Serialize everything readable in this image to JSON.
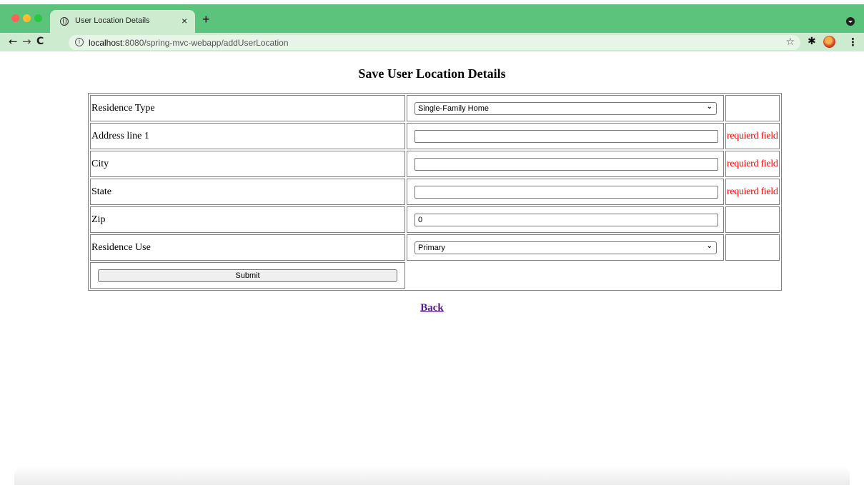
{
  "browser": {
    "tab_title": "User Location Details",
    "tab_close": "×",
    "new_tab": "+",
    "url_host": "localhost",
    "url_path": ":8080/spring-mvc-webapp/addUserLocation",
    "nav_back": "←",
    "nav_forward": "→",
    "nav_reload": "C",
    "info_glyph": "i",
    "star_glyph": "☆",
    "extensions_glyph": "✱",
    "menu_glyph": "⋮"
  },
  "page": {
    "title": "Save User Location Details",
    "rows": [
      {
        "label": "Residence Type",
        "control": "select",
        "value": "Single-Family Home",
        "error": ""
      },
      {
        "label": "Address line 1",
        "control": "input",
        "value": "",
        "error": "requierd field"
      },
      {
        "label": "City",
        "control": "input",
        "value": "",
        "error": "requierd field"
      },
      {
        "label": "State",
        "control": "input",
        "value": "",
        "error": "requierd field"
      },
      {
        "label": "Zip",
        "control": "input",
        "value": "0",
        "error": ""
      },
      {
        "label": "Residence Use",
        "control": "select",
        "value": "Primary",
        "error": ""
      }
    ],
    "submit_label": "Submit",
    "back_link": "Back"
  },
  "colors": {
    "tabstrip": "#5bc37b",
    "toolbar": "#cdeccf",
    "error_text": "#ff0000",
    "link_visited": "#551a8b"
  }
}
